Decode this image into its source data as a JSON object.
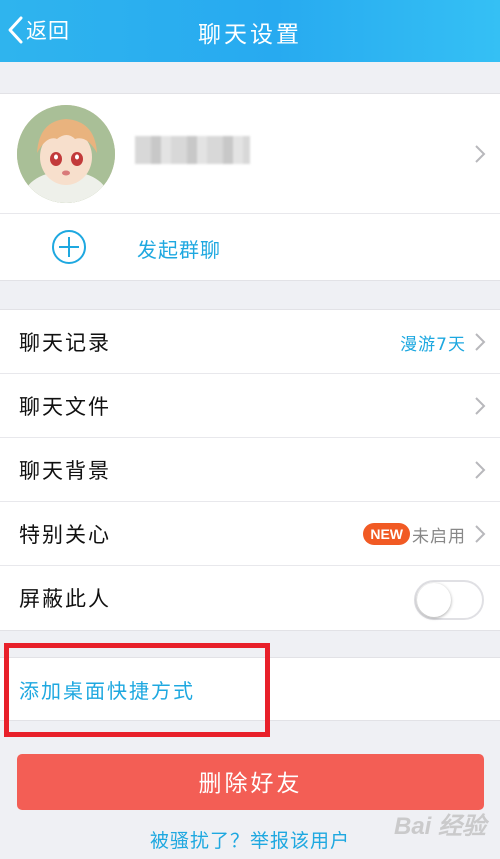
{
  "header": {
    "back_label": "返回",
    "title": "聊天设置"
  },
  "profile": {
    "name": "",
    "group_chat_label": "发起群聊"
  },
  "settings": {
    "rows": [
      {
        "label": "聊天记录",
        "value": "漫游7天",
        "value_color": "#1ea8e0"
      },
      {
        "label": "聊天文件",
        "value": ""
      },
      {
        "label": "聊天背景",
        "value": ""
      },
      {
        "label": "特别关心",
        "badge": "NEW",
        "value": "未启用",
        "value_color": "#888888"
      },
      {
        "label": "屏蔽此人",
        "toggle_on": false
      }
    ]
  },
  "shortcut": {
    "label": "添加桌面快捷方式"
  },
  "actions": {
    "delete_label": "删除好友",
    "report_label": "被骚扰了？举报该用户"
  },
  "watermark": {
    "text": "Bai 经验"
  },
  "colors": {
    "header_bg": "#27aaf0",
    "accent": "#1ea8e0",
    "delete": "#f35e55",
    "new_badge": "#f15a24",
    "highlight": "#e8202a"
  }
}
